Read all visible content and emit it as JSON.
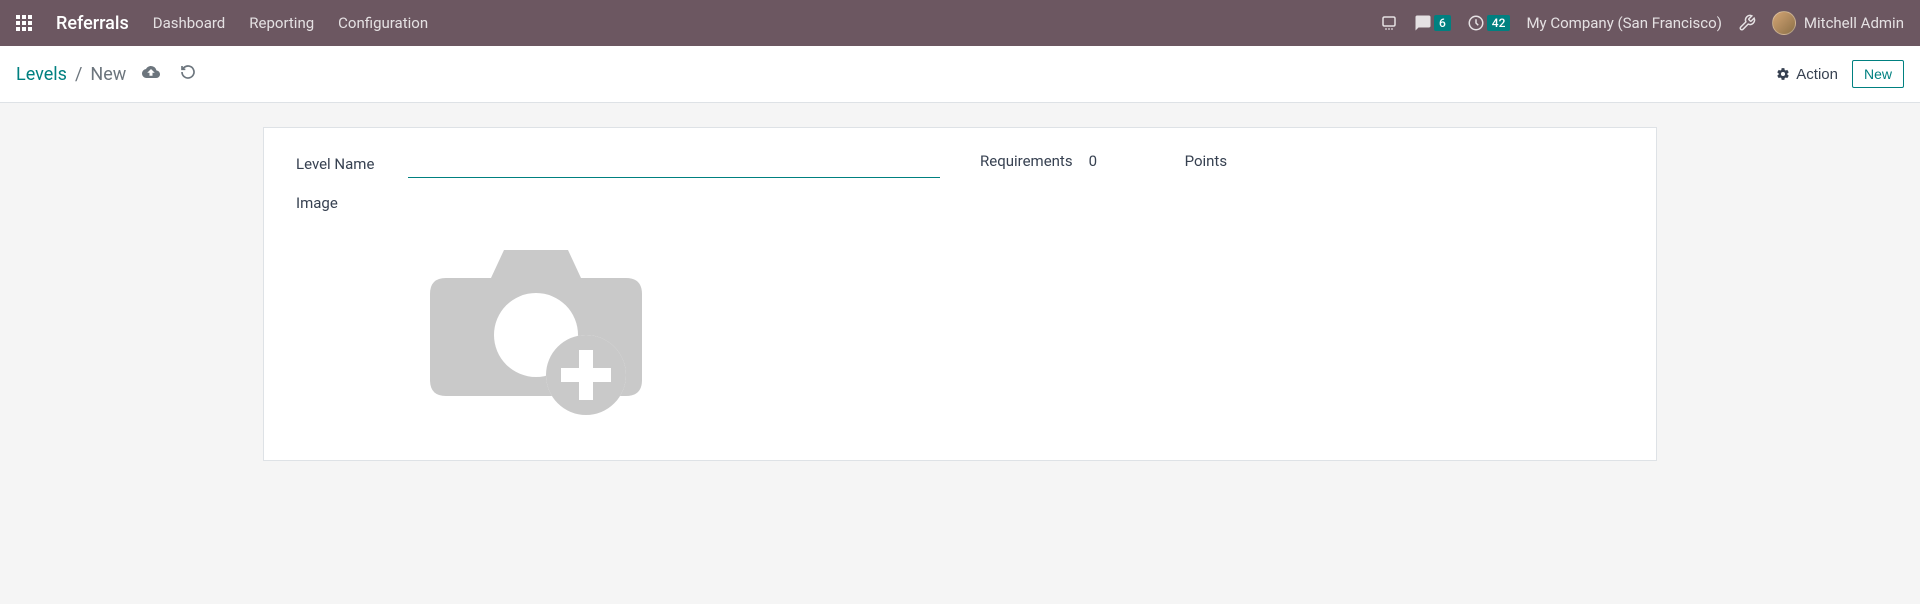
{
  "navbar": {
    "brand": "Referrals",
    "links": [
      {
        "label": "Dashboard"
      },
      {
        "label": "Reporting"
      },
      {
        "label": "Configuration"
      }
    ],
    "messages_badge": "6",
    "activities_badge": "42",
    "company": "My Company (San Francisco)",
    "user": "Mitchell Admin"
  },
  "control": {
    "breadcrumb_root": "Levels",
    "breadcrumb_sep": "/",
    "breadcrumb_current": "New",
    "action_label": "Action",
    "new_label": "New"
  },
  "form": {
    "level_name_label": "Level Name",
    "level_name_value": "",
    "requirements_label": "Requirements",
    "requirements_value": "0",
    "points_label": "Points",
    "image_label": "Image"
  }
}
